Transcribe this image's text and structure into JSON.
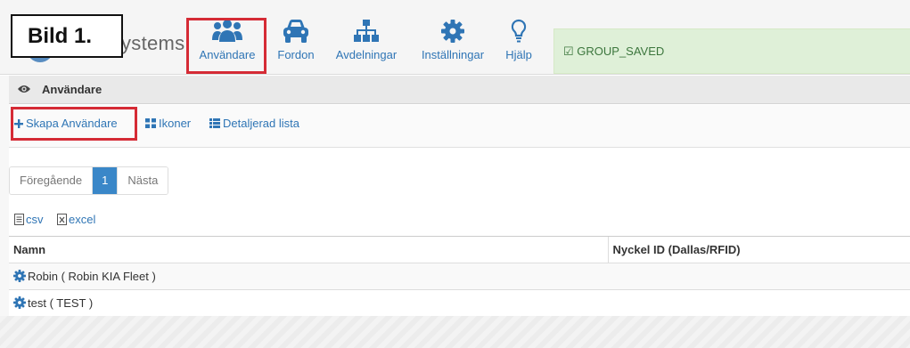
{
  "annotation": {
    "label": "Bild 1."
  },
  "brand": {
    "text": "ystems"
  },
  "nav": {
    "items": [
      {
        "label": "Användare",
        "icon": "users-icon"
      },
      {
        "label": "Fordon",
        "icon": "car-icon"
      },
      {
        "label": "Avdelningar",
        "icon": "sitemap-icon"
      },
      {
        "label": "Inställningar",
        "icon": "gear-icon"
      },
      {
        "label": "Hjälp",
        "icon": "lightbulb-icon"
      }
    ]
  },
  "alert": {
    "text": "GROUP_SAVED",
    "icon": "check-square-icon"
  },
  "panel": {
    "title": "Användare",
    "icon": "eye-icon"
  },
  "toolbar": {
    "create_label": "Skapa Användare",
    "icons_label": "Ikoner",
    "detail_label": "Detaljerad lista"
  },
  "pagination": {
    "prev": "Föregående",
    "current": "1",
    "next": "Nästa"
  },
  "export": {
    "csv": "csv",
    "excel": "excel"
  },
  "table": {
    "columns": [
      "Namn",
      "Nyckel ID (Dallas/RFID)"
    ],
    "rows": [
      {
        "name": "Robin ( Robin KIA Fleet )",
        "key_id": ""
      },
      {
        "name": "test ( TEST )",
        "key_id": ""
      }
    ]
  },
  "colors": {
    "link": "#2f75b5",
    "highlight": "#d52b35",
    "alert_bg": "#dff0d8",
    "alert_text": "#3c763d",
    "pager_active": "#3a87c8"
  }
}
